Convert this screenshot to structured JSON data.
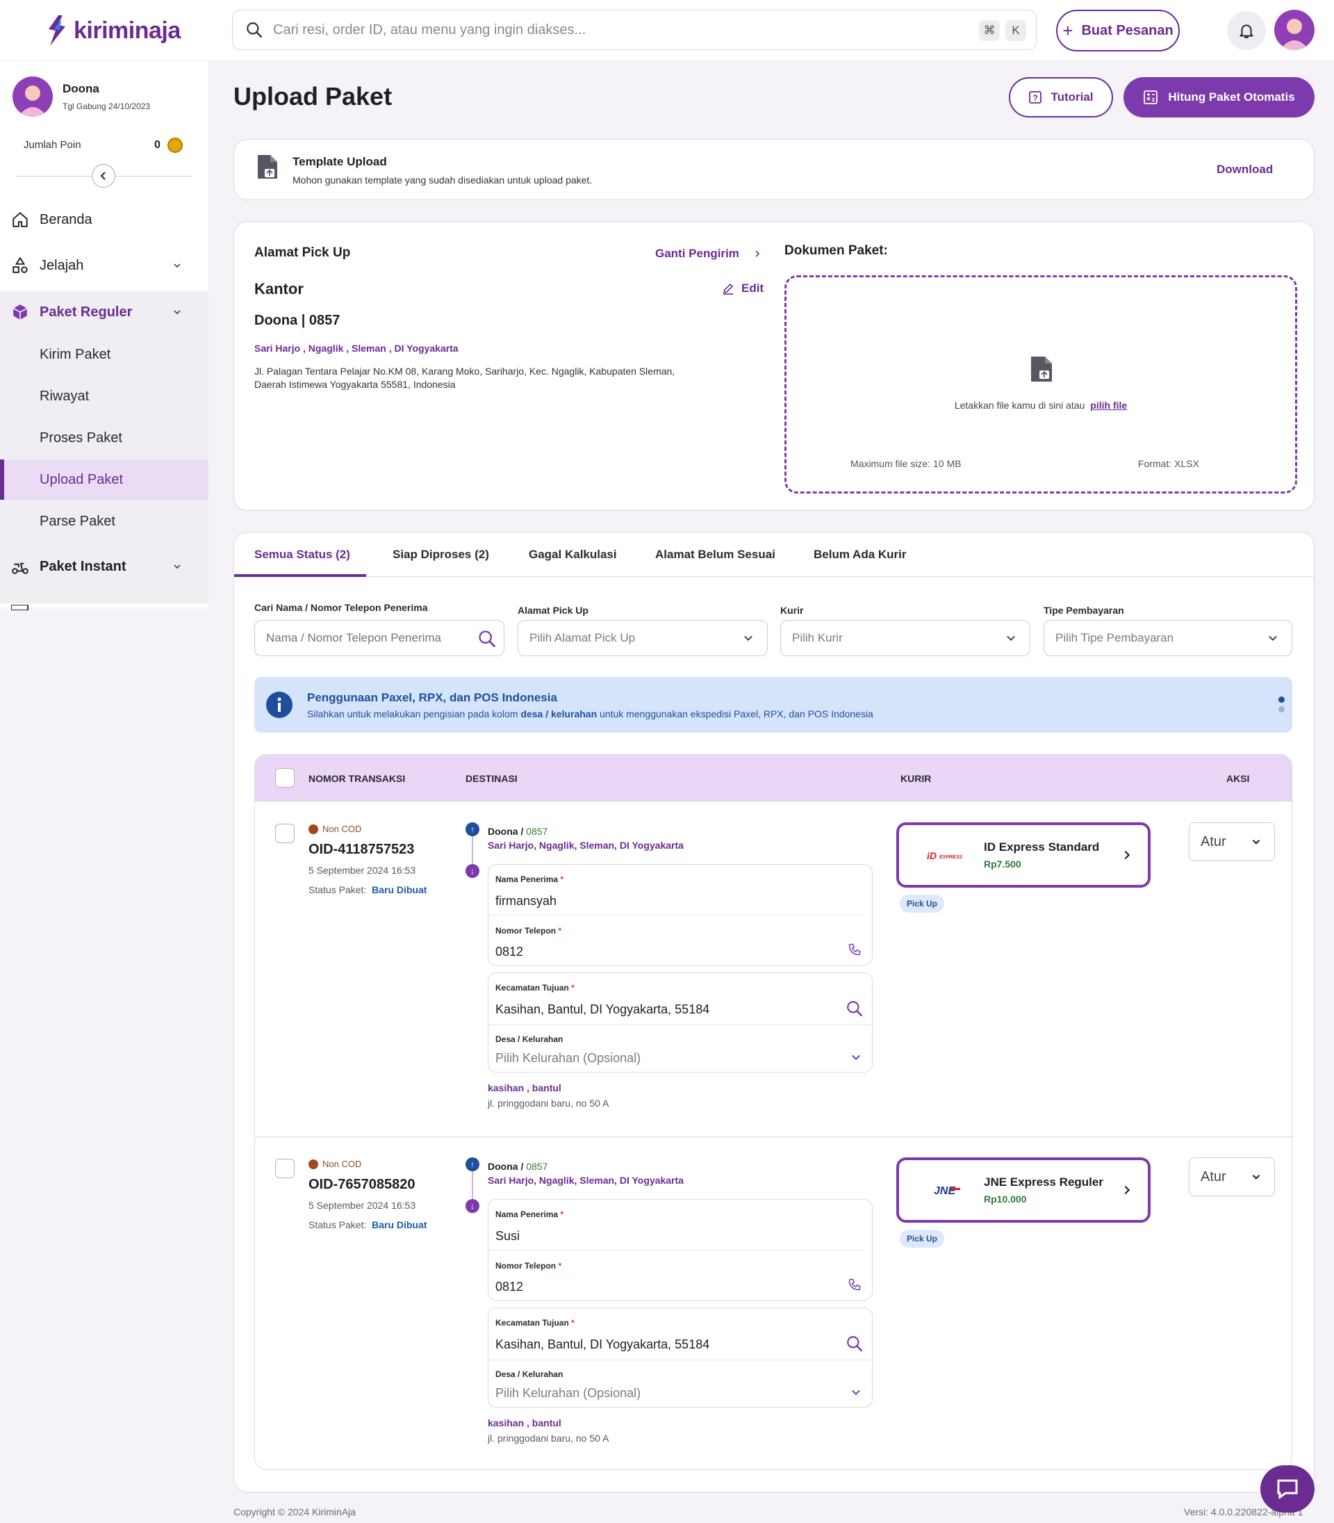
{
  "brand": {
    "name": "kiriminaja",
    "accent": "#6b2c91"
  },
  "header": {
    "search_placeholder": "Cari resi, order ID, atau menu yang ingin diakses...",
    "shortcut_cmd": "⌘",
    "shortcut_key": "K",
    "create_order_label": "Buat Pesanan",
    "bell_icon": "bell-icon",
    "avatar_icon": "user-avatar"
  },
  "sidebar": {
    "user_name": "Doona",
    "join_date": "Tgl Gabung 24/10/2023",
    "points_label": "Jumlah Poin",
    "points_value": "0",
    "nav": [
      {
        "label": "Beranda",
        "icon": "home-icon"
      },
      {
        "label": "Jelajah",
        "icon": "shapes-icon"
      },
      {
        "label": "Paket Reguler",
        "icon": "box-icon"
      },
      {
        "label": "Paket Instant",
        "icon": "scooter-icon"
      }
    ],
    "submenu": [
      "Kirim Paket",
      "Riwayat",
      "Proses Paket",
      "Upload Paket",
      "Parse Paket"
    ]
  },
  "page": {
    "title": "Upload Paket",
    "tutorial_label": "Tutorial",
    "hitung_label": "Hitung Paket Otomatis"
  },
  "template": {
    "title": "Template Upload",
    "subtitle": "Mohon gunakan template yang sudah disediakan untuk upload paket.",
    "download_label": "Download"
  },
  "pickup": {
    "heading": "Alamat Pick Up",
    "change_label": "Ganti Pengirim",
    "place": "Kantor",
    "edit_label": "Edit",
    "sender": "Doona | 0857",
    "region": "Sari Harjo , Ngaglik , Sleman , DI Yogyakarta",
    "address": "Jl. Palagan Tentara Pelajar No.KM 08, Karang Moko, Sariharjo, Kec. Ngaglik, Kabupaten Sleman, Daerah Istimewa Yogyakarta 55581, Indonesia"
  },
  "dokumen": {
    "heading": "Dokumen Paket:",
    "drop_text": "Letakkan file kamu di sini atau",
    "pick_label": "pilih file",
    "max_size": "Maximum file size: 10 MB",
    "format": "Format: XLSX"
  },
  "tabs": [
    "Semua Status (2)",
    "Siap Diproses (2)",
    "Gagal Kalkulasi",
    "Alamat Belum Sesuai",
    "Belum Ada Kurir"
  ],
  "filters": {
    "search_label": "Cari Nama / Nomor Telepon Penerima",
    "search_placeholder": "Nama / Nomor Telepon Penerima",
    "pickup_label": "Alamat Pick Up",
    "pickup_placeholder": "Pilih Alamat Pick Up",
    "kurir_label": "Kurir",
    "kurir_placeholder": "Pilih Kurir",
    "payment_label": "Tipe Pembayaran",
    "payment_placeholder": "Pilih Tipe Pembayaran"
  },
  "info": {
    "title": "Penggunaan Paxel, RPX, dan POS Indonesia",
    "text_before": "Silahkan untuk melakukan pengisian pada kolom",
    "text_bold": "desa / kelurahan",
    "text_after": "untuk menggunakan ekspedisi Paxel, RPX, dan POS Indonesia"
  },
  "table": {
    "headers": [
      "NOMOR TRANSAKSI",
      "DESTINASI",
      "KURIR",
      "AKSI"
    ],
    "rows": [
      {
        "cod": "Non COD",
        "oid": "OID-4118757523",
        "date": "5 September 2024 16:53",
        "status_label": "Status Paket:",
        "status": "Baru Dibuat",
        "sender_name": "Doona /",
        "sender_phone": "0857",
        "sender_region": "Sari Harjo, Ngaglik, Sleman, DI Yogyakarta",
        "recv_name_label": "Nama Penerima",
        "recv_name": "firmansyah",
        "phone_label": "Nomor Telepon",
        "phone": "0812",
        "kec_label": "Kecamatan Tujuan",
        "kec": "Kasihan, Bantul, DI Yogyakarta, 55184",
        "desa_label": "Desa / Kelurahan",
        "desa_placeholder": "Pilih Kelurahan (Opsional)",
        "kel": "kasihan , bantul",
        "alamat": "jl. pringgodani baru, no 50 A",
        "kurir_logo": "ID EXPRESS",
        "kurir_name": "ID Express Standard",
        "kurir_price": "Rp7.500",
        "pickup": "Pick Up",
        "aksi": "Atur"
      },
      {
        "cod": "Non COD",
        "oid": "OID-7657085820",
        "date": "5 September 2024 16:53",
        "status_label": "Status Paket:",
        "status": "Baru Dibuat",
        "sender_name": "Doona /",
        "sender_phone": "0857",
        "sender_region": "Sari Harjo, Ngaglik, Sleman, DI Yogyakarta",
        "recv_name_label": "Nama Penerima",
        "recv_name": "Susi",
        "phone_label": "Nomor Telepon",
        "phone": "0812",
        "kec_label": "Kecamatan Tujuan",
        "kec": "Kasihan, Bantul, DI Yogyakarta, 55184",
        "desa_label": "Desa / Kelurahan",
        "desa_placeholder": "Pilih Kelurahan (Opsional)",
        "kel": "kasihan , bantul",
        "alamat": "jl. pringgodani baru, no 50 A",
        "kurir_logo": "JNE",
        "kurir_name": "JNE Express Reguler",
        "kurir_price": "Rp10.000",
        "pickup": "Pick Up",
        "aksi": "Atur"
      }
    ]
  },
  "footer": {
    "copyright": "Copyright © 2024 KiriminAja",
    "version": "Versi: 4.0.0.220822-alpha 1"
  }
}
